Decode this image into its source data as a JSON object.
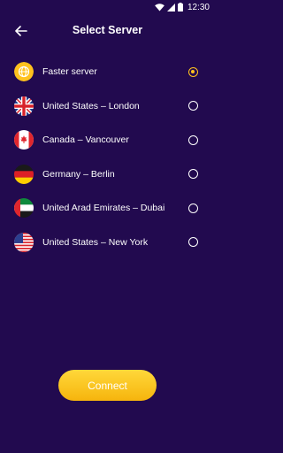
{
  "status_bar": {
    "time": "12:30"
  },
  "header": {
    "title": "Select Server"
  },
  "servers": [
    {
      "name": "Faster server",
      "icon": "globe-icon",
      "selected": true
    },
    {
      "name": "United States – London",
      "icon": "uk-flag-icon",
      "selected": false
    },
    {
      "name": "Canada – Vancouver",
      "icon": "canada-flag-icon",
      "selected": false
    },
    {
      "name": "Germany – Berlin",
      "icon": "germany-flag-icon",
      "selected": false
    },
    {
      "name": "United Arad Emirates – Dubai",
      "icon": "uae-flag-icon",
      "selected": false
    },
    {
      "name": "United States – New York",
      "icon": "us-flag-icon",
      "selected": false
    }
  ],
  "connect_button": {
    "label": "Connect"
  },
  "colors": {
    "background": "#220a4f",
    "accent": "#ffc21e"
  }
}
